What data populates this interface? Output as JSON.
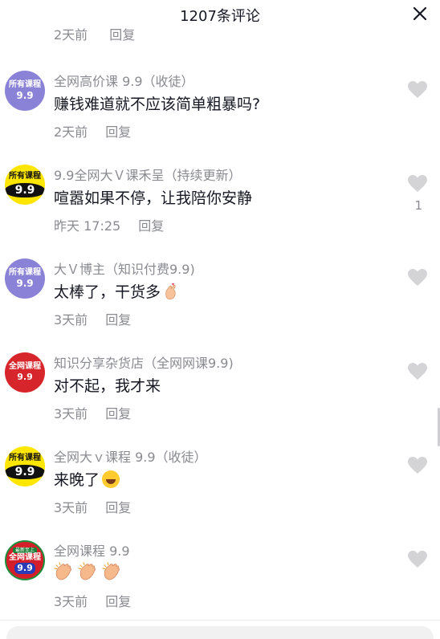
{
  "header": {
    "title": "1207条评论",
    "close_icon": "close-icon"
  },
  "partial_row": {
    "time": "2天前",
    "reply": "回复"
  },
  "comments": [
    {
      "avatar_top": "所有课程",
      "avatar_bottom": "9.9",
      "nickname": "全网高价课 9.9（收徒）",
      "text": "赚钱难道就不应该简单粗暴吗?",
      "time": "2天前",
      "reply": "回复",
      "likes": ""
    },
    {
      "avatar_top": "所有课程",
      "avatar_bottom": "9.9",
      "nickname": "9.9全网大Ｖ课禾呈（持续更新）",
      "text": "喧嚣如果不停，让我陪你安静",
      "time": "昨天 17:25",
      "reply": "回复",
      "likes": "1"
    },
    {
      "avatar_top": "所有课程",
      "avatar_bottom": "9.9",
      "nickname": "大Ｖ博主（知识付费9.9)",
      "text": "太棒了，干货多",
      "emoji": "finger-heart-emoji",
      "time": "3天前",
      "reply": "回复",
      "likes": ""
    },
    {
      "avatar_top": "全网课程",
      "avatar_bottom": "9.9",
      "nickname": "知识分享杂货店（全网网课9.9)",
      "text": "对不起，我才来",
      "time": "3天前",
      "reply": "回复",
      "likes": ""
    },
    {
      "avatar_top": "所有课程",
      "avatar_bottom": "9.9",
      "nickname": "全网大ｖ课程 9.9（收徒）",
      "text": "来晚了",
      "emoji": "rolling-laughing-emoji",
      "time": "3天前",
      "reply": "回复",
      "likes": ""
    },
    {
      "avatar_tiny": "最新至上",
      "avatar_top": "全网课程",
      "avatar_bottom": "9.9",
      "nickname": "全网课程 9.9",
      "text": "",
      "emoji": "clapping-hands-emoji",
      "time": "3天前",
      "reply": "回复",
      "likes": ""
    }
  ],
  "colors": {
    "meta_gray": "#8a8b91",
    "text_dark": "#161823",
    "heart_gray": "#d4d4d6"
  }
}
